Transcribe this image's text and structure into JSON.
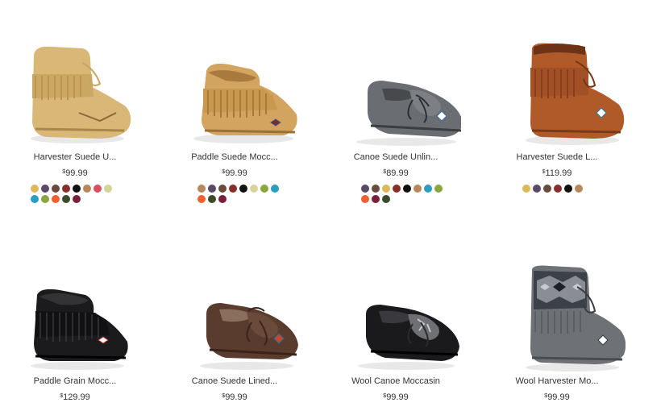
{
  "products": [
    {
      "name": "Harvester Suede U...",
      "currency": "$",
      "price": "99.99",
      "image": "tan-fringe-ankle-boot",
      "swatches": [
        "#e0b85c",
        "#5a4a6a",
        "#6a4a3a",
        "#8a2e2a",
        "#111111",
        "#b8885a",
        "#d85060",
        "#d6d49a",
        "#2a9ec2",
        "#8aa63c",
        "#f06030",
        "#3a4a2a",
        "#7a1e3a"
      ]
    },
    {
      "name": "Paddle Suede Mocc...",
      "currency": "$",
      "price": "99.99",
      "image": "tan-fringe-moccasin-boot",
      "swatches": [
        "#b8885a",
        "#5a4a6a",
        "#6a4a3a",
        "#8a2e2a",
        "#111111",
        "#d6d49a",
        "#8aa63c",
        "#2a9ec2",
        "#f06030",
        "#3a4a2a",
        "#7a1e3a"
      ]
    },
    {
      "name": "Canoe Suede Unlin...",
      "currency": "$",
      "price": "89.99",
      "image": "grey-suede-moccasin",
      "swatches": [
        "#5a4a6a",
        "#6a4a3a",
        "#e0b85c",
        "#8a2e2a",
        "#111111",
        "#b8885a",
        "#2a9ec2",
        "#8aa63c",
        "#f06030",
        "#7a1e3a",
        "#3a4a2a"
      ]
    },
    {
      "name": "Harvester Suede L...",
      "currency": "$",
      "price": "119.99",
      "image": "rust-lined-ankle-boot",
      "swatches": [
        "#e0b85c",
        "#5a4a6a",
        "#6a4a3a",
        "#8a2e2a",
        "#111111",
        "#b8885a"
      ]
    },
    {
      "name": "Paddle Grain Mocc...",
      "currency": "$",
      "price": "129.99",
      "image": "black-fringe-moccasin-boot",
      "swatches": []
    },
    {
      "name": "Canoe Suede Lined...",
      "currency": "$",
      "price": "99.99",
      "image": "brown-lined-moccasin",
      "swatches": []
    },
    {
      "name": "Wool Canoe Moccasin",
      "currency": "$",
      "price": "99.99",
      "image": "black-wool-moccasin",
      "swatches": []
    },
    {
      "name": "Wool Harvester Mo...",
      "currency": "$",
      "price": "99.99",
      "image": "grey-wool-ankle-boot",
      "swatches": []
    }
  ]
}
